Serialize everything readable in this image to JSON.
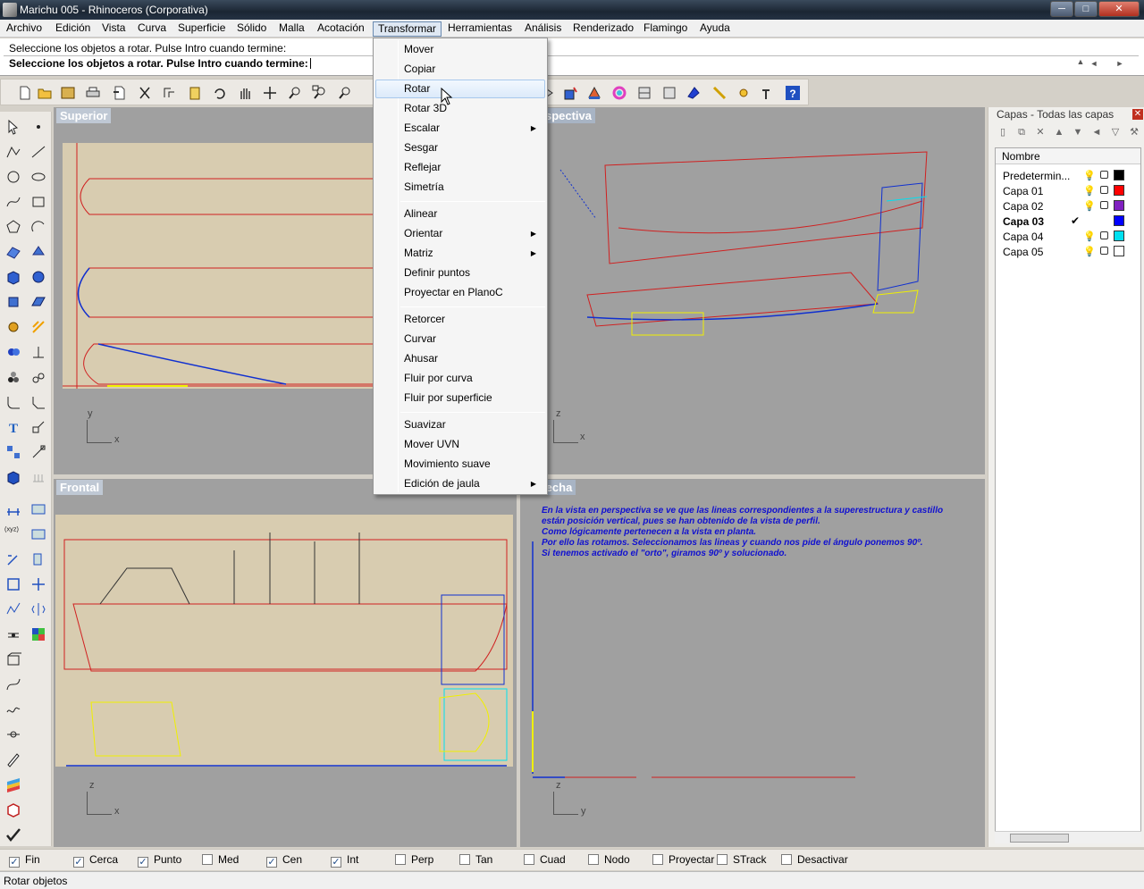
{
  "window": {
    "title": "Marichu 005 - Rhinoceros (Corporativa)",
    "min": "─",
    "max": "□",
    "close": "✕"
  },
  "menubar": [
    "Archivo",
    "Edición",
    "Vista",
    "Curva",
    "Superficie",
    "Sólido",
    "Malla",
    "Acotación",
    "Transformar",
    "Herramientas",
    "Análisis",
    "Renderizado",
    "Flamingo",
    "Ayuda"
  ],
  "command": {
    "history": "Seleccione los objetos a rotar. Pulse Intro cuando termine:",
    "prompt": "Seleccione los objetos a rotar. Pulse Intro cuando termine:"
  },
  "viewports": {
    "top": {
      "label": "Superior",
      "axis_v": "y",
      "axis_h": "x"
    },
    "perspective": {
      "label": "Perspectiva",
      "axis_v": "z",
      "axis_h": "x"
    },
    "front": {
      "label": "Frontal",
      "axis_v": "z",
      "axis_h": "x"
    },
    "right": {
      "label": "Derecha",
      "axis_v": "z",
      "axis_h": "y"
    }
  },
  "notes": [
    "En la vista en perspectiva se ve que las lineas correspondientes a la superestructura y castillo",
    "están posición vertical, pues se han obtenido de la vista de perfil.",
    "Como lógicamente pertenecen a la vista en planta.",
    "Por ello las rotamos. Seleccionamos las lineas y cuando nos pide el ángulo ponemos 90º.",
    "Si tenemos activado el \"orto\", giramos 90º y solucionado."
  ],
  "layers": {
    "header": "Capas - Todas las capas",
    "column": "Nombre",
    "rows": [
      {
        "name": "Predetermin...",
        "color": "#000000",
        "current": false
      },
      {
        "name": "Capa 01",
        "color": "#ff0000",
        "current": false
      },
      {
        "name": "Capa 02",
        "color": "#8020c0",
        "current": false
      },
      {
        "name": "Capa 03",
        "color": "#0000ff",
        "current": true
      },
      {
        "name": "Capa 04",
        "color": "#00e0f0",
        "current": false
      },
      {
        "name": "Capa 05",
        "color": "#ffffff",
        "current": false
      }
    ]
  },
  "osnap": [
    {
      "label": "Fin",
      "checked": true
    },
    {
      "label": "Cerca",
      "checked": true
    },
    {
      "label": "Punto",
      "checked": true
    },
    {
      "label": "Med",
      "checked": false
    },
    {
      "label": "Cen",
      "checked": true
    },
    {
      "label": "Int",
      "checked": true
    },
    {
      "label": "Perp",
      "checked": false
    },
    {
      "label": "Tan",
      "checked": false
    },
    {
      "label": "Cuad",
      "checked": false
    },
    {
      "label": "Nodo",
      "checked": false
    },
    {
      "label": "Proyectar",
      "checked": false
    },
    {
      "label": "STrack",
      "checked": false
    },
    {
      "label": "Desactivar",
      "checked": false
    }
  ],
  "status": "Rotar objetos",
  "transform_menu": [
    {
      "label": "Mover",
      "submenu": false,
      "highlight": false
    },
    {
      "label": "Copiar",
      "submenu": false,
      "highlight": false
    },
    {
      "label": "Rotar",
      "submenu": false,
      "highlight": true
    },
    {
      "label": "Rotar 3D",
      "submenu": false,
      "highlight": false
    },
    {
      "label": "Escalar",
      "submenu": true,
      "highlight": false
    },
    {
      "label": "Sesgar",
      "submenu": false,
      "highlight": false
    },
    {
      "label": "Reflejar",
      "submenu": false,
      "highlight": false
    },
    {
      "label": "Simetría",
      "submenu": false,
      "highlight": false
    },
    {
      "label": "Alinear",
      "submenu": false,
      "highlight": false
    },
    {
      "label": "Orientar",
      "submenu": true,
      "highlight": false
    },
    {
      "label": "Matriz",
      "submenu": true,
      "highlight": false
    },
    {
      "label": "Definir puntos",
      "submenu": false,
      "highlight": false
    },
    {
      "label": "Proyectar en PlanoC",
      "submenu": false,
      "highlight": false
    },
    {
      "label": "Retorcer",
      "submenu": false,
      "highlight": false
    },
    {
      "label": "Curvar",
      "submenu": false,
      "highlight": false
    },
    {
      "label": "Ahusar",
      "submenu": false,
      "highlight": false
    },
    {
      "label": "Fluir por curva",
      "submenu": false,
      "highlight": false
    },
    {
      "label": "Fluir por superficie",
      "submenu": false,
      "highlight": false
    },
    {
      "label": "Suavizar",
      "submenu": false,
      "highlight": false
    },
    {
      "label": "Mover UVN",
      "submenu": false,
      "highlight": false
    },
    {
      "label": "Movimiento suave",
      "submenu": false,
      "highlight": false
    },
    {
      "label": "Edición de jaula",
      "submenu": true,
      "highlight": false
    }
  ],
  "colors": {
    "accent": "#dfe8f3",
    "drawing_red": "#e02020",
    "drawing_blue": "#1030d0",
    "drawing_yellow": "#f0f000",
    "viewport_bg": "#a0a0a0"
  },
  "icons": {
    "cursor": "arrow-pointer-icon",
    "submenu": "chevron-right-icon"
  }
}
